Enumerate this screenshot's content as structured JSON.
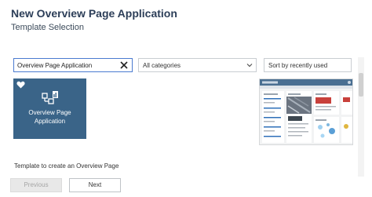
{
  "header": {
    "title": "New Overview Page Application",
    "subtitle": "Template Selection"
  },
  "filters": {
    "search_value": "Overview Page Application",
    "category": "All categories",
    "sort": "Sort by recently used"
  },
  "templates": [
    {
      "label_line1": "Overview Page",
      "label_line2": "Application",
      "favorite": true,
      "icon": "overview-page-icon",
      "selected": true
    }
  ],
  "description": "Template to create an Overview Page",
  "buttons": {
    "previous": "Previous",
    "next": "Next"
  },
  "colors": {
    "title": "#2c3e58",
    "tile_bg": "#3a6488",
    "focus_border": "#4b7bd0",
    "preview_header": "#4a6f92",
    "kpi_red": "#c8403b"
  },
  "icons": {
    "search_clear": "close-icon",
    "category_dropdown": "chevron-down-icon",
    "favorite": "heart-icon"
  }
}
